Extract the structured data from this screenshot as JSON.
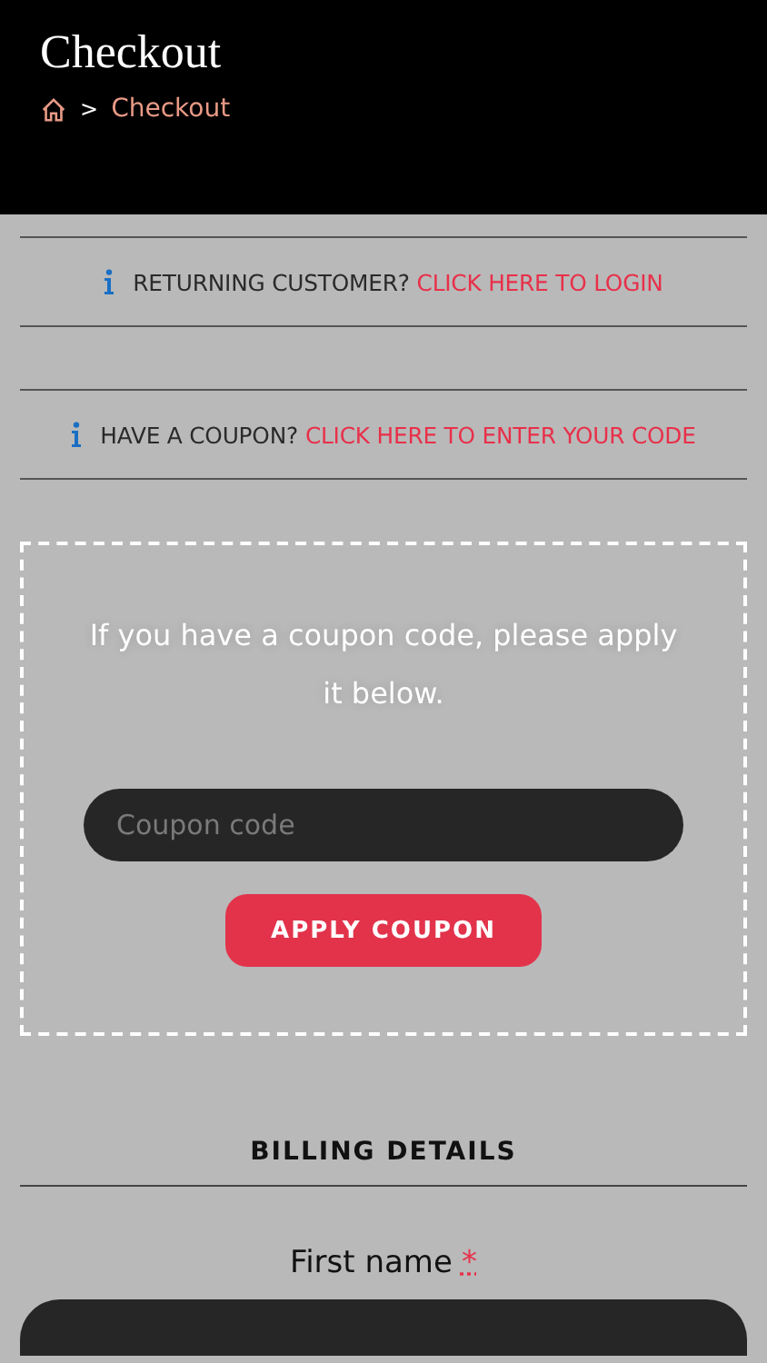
{
  "header": {
    "title": "Checkout",
    "breadcrumb": {
      "separator": ">",
      "current": "Checkout"
    }
  },
  "notices": [
    {
      "text": "RETURNING CUSTOMER?",
      "link": "CLICK HERE TO LOGIN"
    },
    {
      "text": "HAVE A COUPON?",
      "link": "CLICK HERE TO ENTER YOUR CODE"
    }
  ],
  "coupon_form": {
    "message": "If you have a coupon code, please apply it below.",
    "field": {
      "placeholder": "Coupon code"
    },
    "button": "APPLY COUPON"
  },
  "billing": {
    "heading": "BILLING DETAILS",
    "fields": [
      {
        "label": "First name",
        "required_mark": "*"
      }
    ]
  }
}
